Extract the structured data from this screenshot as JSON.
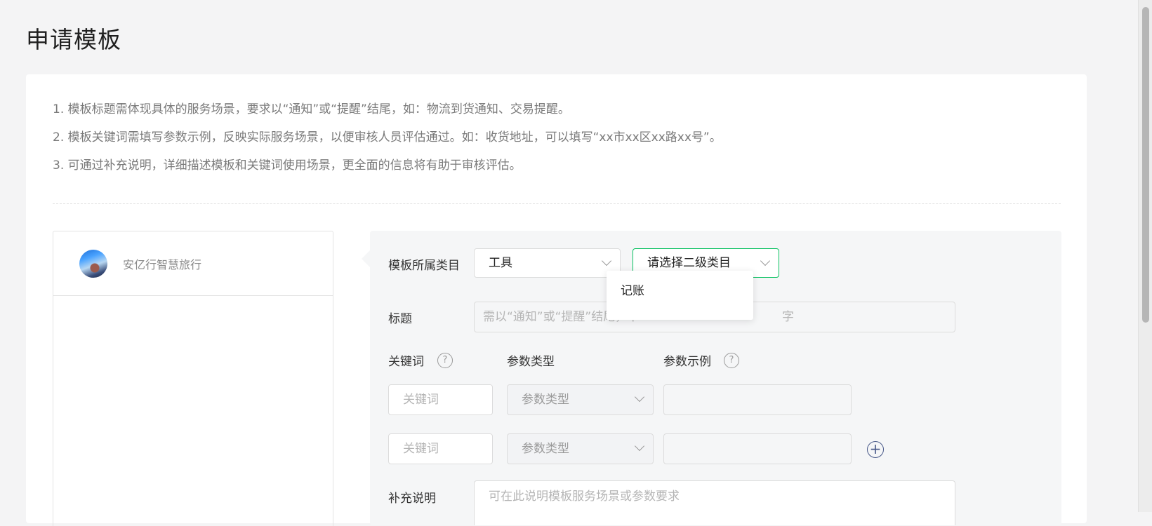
{
  "page": {
    "title": "申请模板"
  },
  "notes": [
    "1. 模板标题需体现具体的服务场景，要求以“通知”或“提醒”结尾，如：物流到货通知、交易提醒。",
    "2. 模板关键词需填写参数示例，反映实际服务场景，以便审核人员评估通过。如：收货地址，可以填写“xx市xx区xx路xx号”。",
    "3. 可通过补充说明，详细描述模板和关键词使用场景，更全面的信息将有助于审核评估。"
  ],
  "preview": {
    "account_name": "安亿行智慧旅行"
  },
  "form": {
    "category_label": "模板所属类目",
    "category_value": "工具",
    "subcategory_placeholder": "请选择二级类目",
    "subcategory_options": [
      "记账"
    ],
    "title_label": "标题",
    "title_placeholder_left": "需以“通知”或“提醒”结尾，不",
    "title_placeholder_right": "字",
    "keyword_header": "关键词",
    "param_type_header": "参数类型",
    "param_example_header": "参数示例",
    "help_glyph": "?",
    "rows": [
      {
        "keyword_placeholder": "关键词",
        "param_type_placeholder": "参数类型"
      },
      {
        "keyword_placeholder": "关键词",
        "param_type_placeholder": "参数类型"
      }
    ],
    "add_glyph": "+",
    "note_label": "补充说明",
    "note_placeholder": "可在此说明模板服务场景或参数要求"
  },
  "colors": {
    "accent_green": "#07c160",
    "add_icon": "#4a5a8a"
  }
}
